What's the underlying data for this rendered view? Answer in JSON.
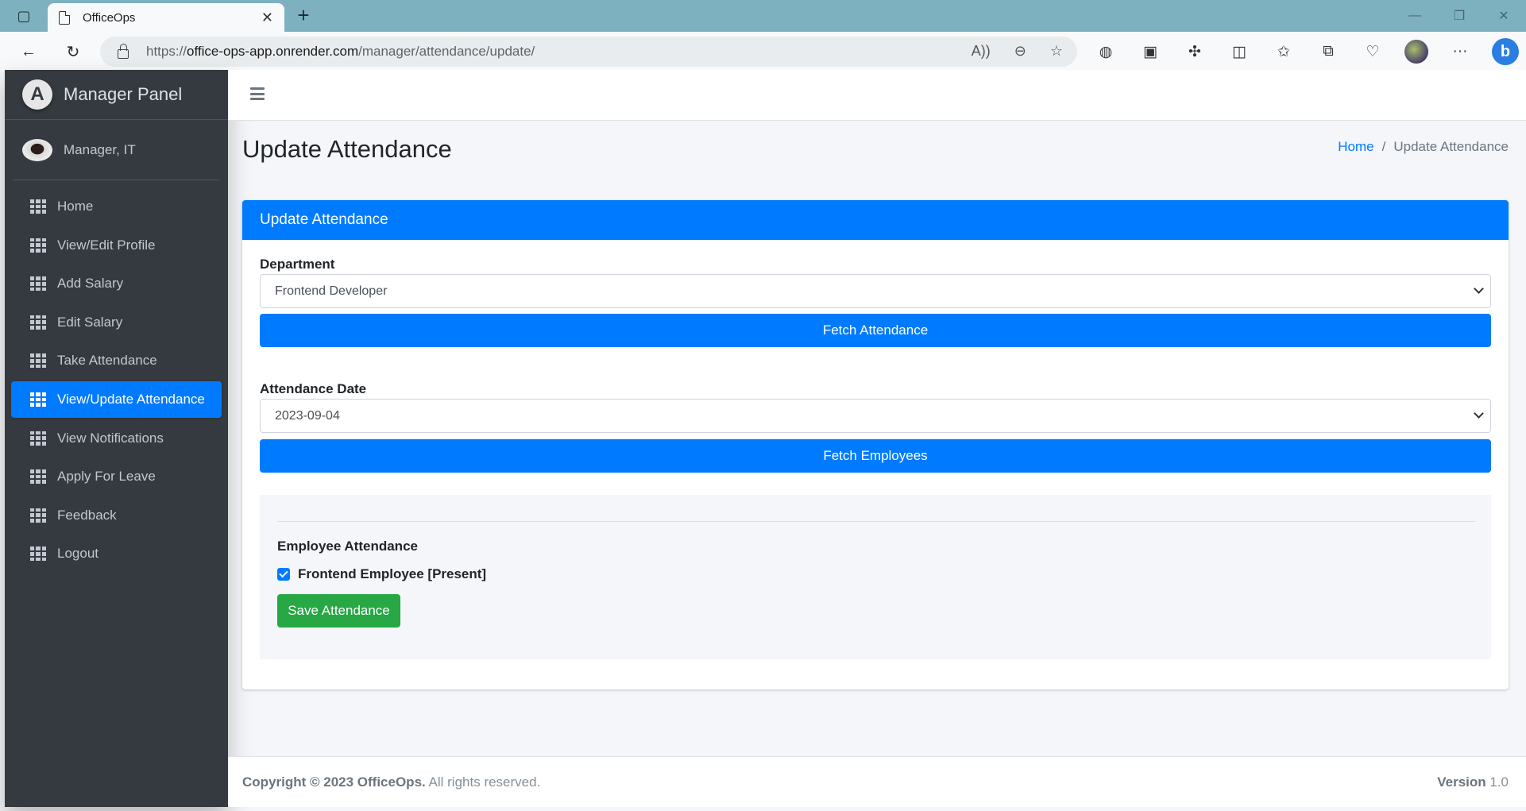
{
  "browser": {
    "tab_title": "OfficeOps",
    "url_prefix": "https://",
    "url_host": "office-ops-app.onrender.com",
    "url_path": "/manager/attendance/update/"
  },
  "sidebar": {
    "brand": "Manager Panel",
    "brand_logo_letter": "A",
    "user": "Manager, IT",
    "items": [
      {
        "label": "Home"
      },
      {
        "label": "View/Edit Profile"
      },
      {
        "label": "Add Salary"
      },
      {
        "label": "Edit Salary"
      },
      {
        "label": "Take Attendance"
      },
      {
        "label": "View/Update Attendance",
        "active": true
      },
      {
        "label": "View Notifications"
      },
      {
        "label": "Apply For Leave"
      },
      {
        "label": "Feedback"
      },
      {
        "label": "Logout"
      }
    ]
  },
  "page": {
    "title": "Update Attendance",
    "breadcrumb": {
      "home": "Home",
      "separator": "/",
      "current": "Update Attendance"
    }
  },
  "card": {
    "header": "Update Attendance",
    "department_label": "Department",
    "department_value": "Frontend Developer",
    "fetch_attendance_label": "Fetch Attendance",
    "date_label": "Attendance Date",
    "date_value": "2023-09-04",
    "fetch_employees_label": "Fetch Employees",
    "employee_section_title": "Employee Attendance",
    "employees": [
      {
        "label": "Frontend Employee [Present]",
        "checked": true
      }
    ],
    "save_label": "Save Attendance"
  },
  "footer": {
    "copyright_bold": "Copyright © 2023 OfficeOps.",
    "copyright_rest": " All rights reserved.",
    "version_label": "Version",
    "version_value": " 1.0"
  },
  "colors": {
    "primary": "#007bff",
    "success": "#28a745",
    "sidebar_bg": "#343a40",
    "tabbar_bg": "#7eb1bf"
  }
}
